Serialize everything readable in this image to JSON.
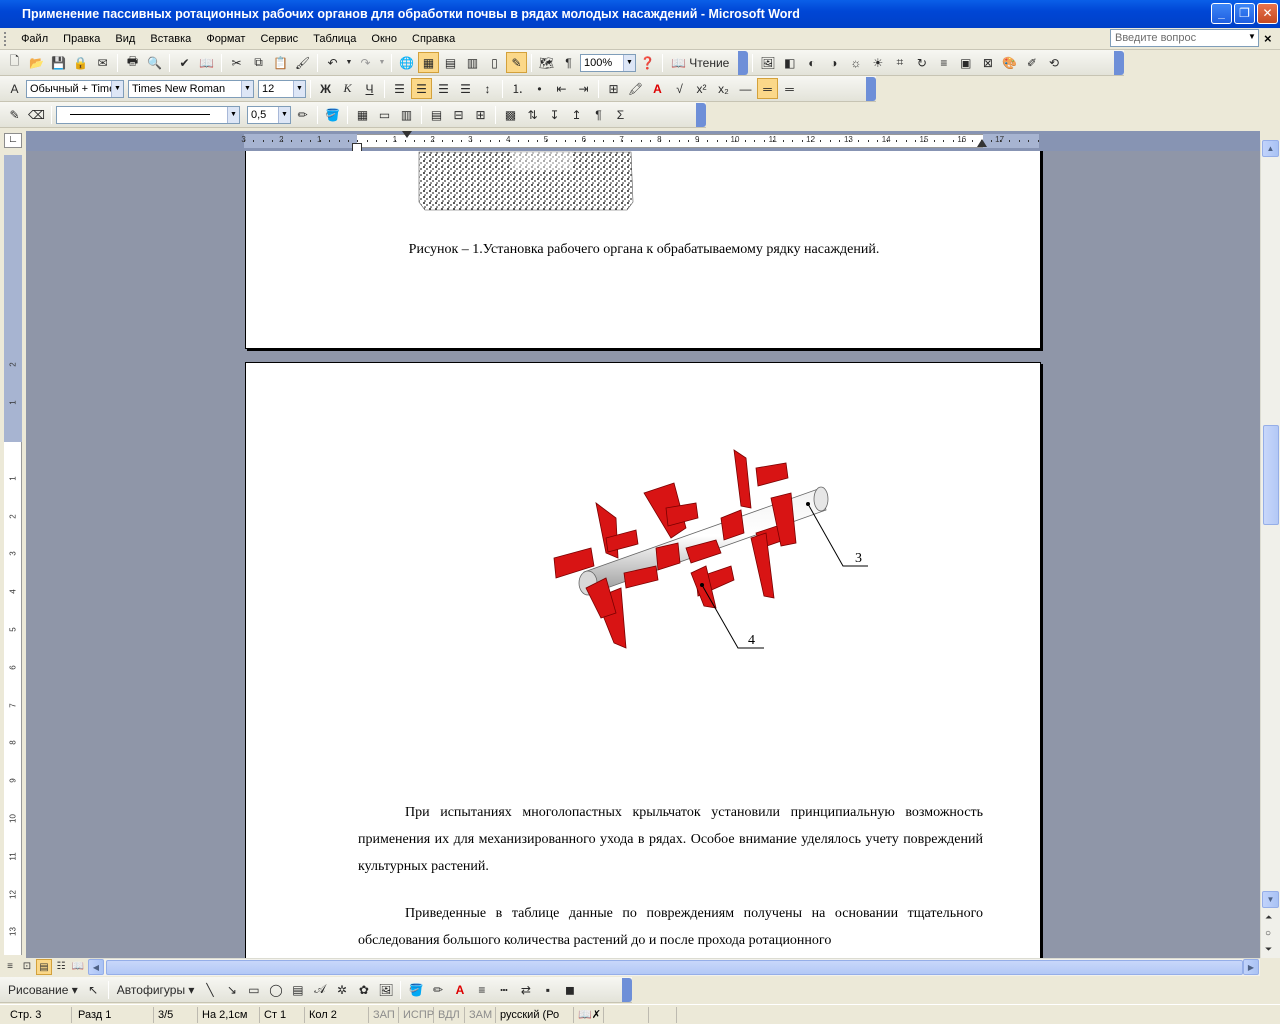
{
  "window": {
    "title": "Применение пассивных ротационных рабочих органов для обработки почвы в рядах молодых насаждений - Microsoft Word",
    "app_icon": "W"
  },
  "menu": {
    "items": [
      "Файл",
      "Правка",
      "Вид",
      "Вставка",
      "Формат",
      "Сервис",
      "Таблица",
      "Окно",
      "Справка"
    ],
    "help_placeholder": "Введите вопрос"
  },
  "standard_toolbar": {
    "zoom": "100%",
    "reading_label": "Чтение"
  },
  "formatting_toolbar": {
    "style": "Обычный + Time",
    "font": "Times New Roman",
    "size": "12",
    "bold": "Ж",
    "italic": "К",
    "underline": "Ч"
  },
  "tables_toolbar": {
    "line_weight": "0,5"
  },
  "rulers": {
    "horizontal_ticks": [
      "3",
      "2",
      "1",
      "1",
      "2",
      "3",
      "4",
      "5",
      "6",
      "7",
      "8",
      "9",
      "10",
      "11",
      "12",
      "13",
      "14",
      "15",
      "16",
      "17"
    ],
    "vertical_ticks": [
      "2",
      "1",
      "1",
      "2",
      "3",
      "4",
      "5",
      "6",
      "7",
      "8",
      "9",
      "10",
      "11",
      "12",
      "13"
    ]
  },
  "document": {
    "caption": "Рисунок – 1.Установка рабочего органа к обрабатываемому рядку насаждений.",
    "figure_label_3": "3",
    "figure_label_4": "4",
    "paragraph1": "При испытаниях многолопастных крыльчаток установили принципиальную возможность применения их для механизированного ухода в рядах. Особое внимание уделялось учету повреждений культурных растений.",
    "paragraph2": "Приведенные в таблице данные по повреждениям получены на основании тщательного обследования большого количества растений до и после прохода ротационного"
  },
  "drawing_toolbar": {
    "draw_label": "Рисование",
    "autoshapes_label": "Автофигуры"
  },
  "status": {
    "page": "Стр. 3",
    "section": "Разд 1",
    "pages": "3/5",
    "at": "На 2,1см",
    "line": "Ст 1",
    "col": "Кол 2",
    "rec": "ЗАП",
    "trk": "ИСПР",
    "ext": "ВДЛ",
    "ovr": "ЗАМ",
    "language": "русский (Ро"
  },
  "colors": {
    "titlebar": "#0a5fe8",
    "impeller_red": "#d81414",
    "workspace": "#8f96a8"
  }
}
